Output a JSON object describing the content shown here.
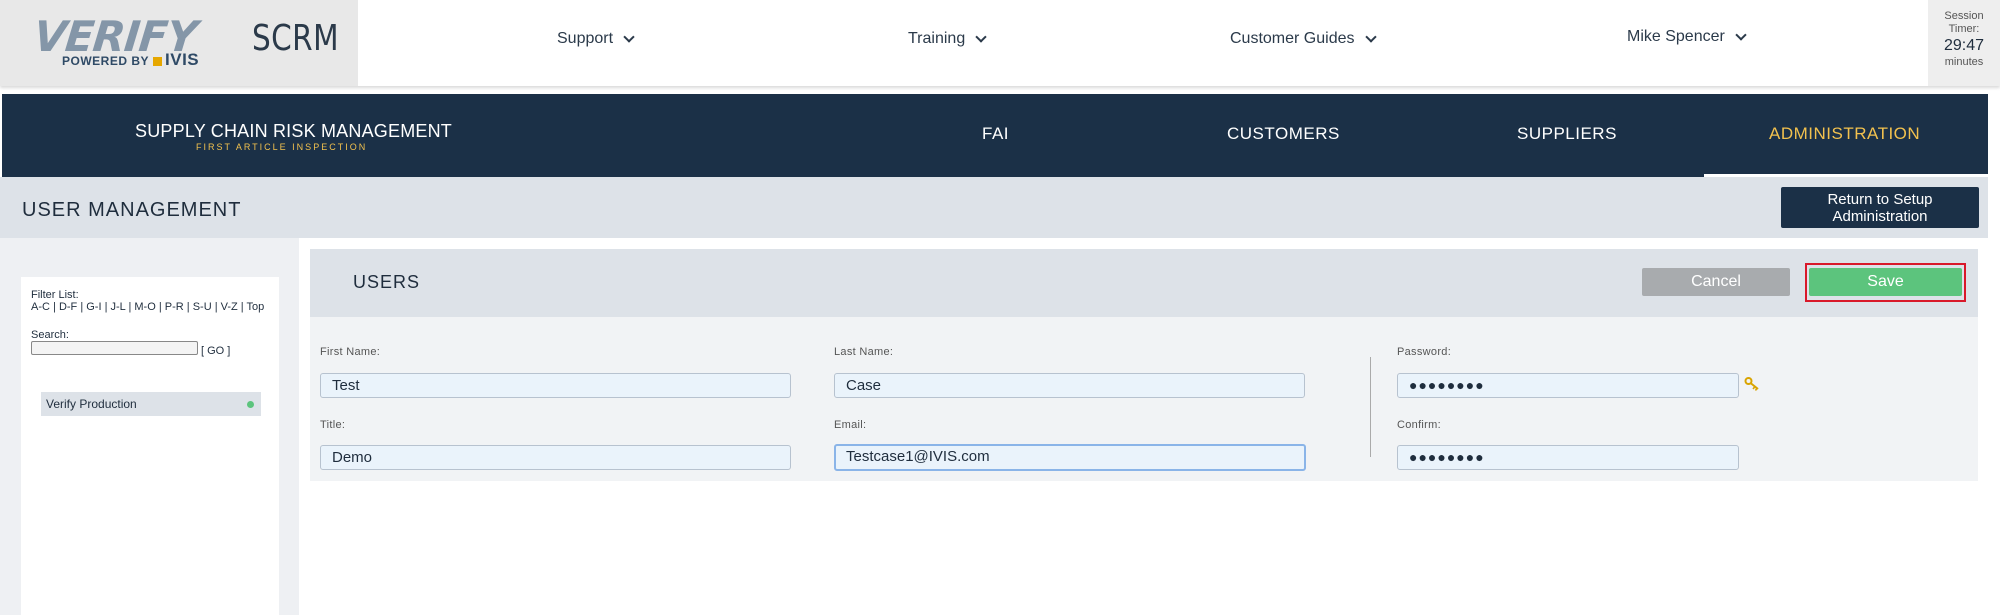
{
  "header": {
    "logo_text": "VERIFY",
    "logo_powered": "POWERED BY",
    "logo_ivis": "IVIS",
    "app_name": "SCRM",
    "nav": [
      "Support",
      "Training",
      "Customer Guides"
    ],
    "user": "Mike Spencer",
    "session": {
      "label1": "Session",
      "label2": "Timer:",
      "time": "29:47",
      "unit": "minutes"
    }
  },
  "mainnav": {
    "brand_title": "SUPPLY CHAIN RISK MANAGEMENT",
    "brand_sub": "FIRST ARTICLE INSPECTION",
    "items": [
      "FAI",
      "CUSTOMERS",
      "SUPPLIERS",
      "ADMINISTRATION"
    ],
    "active": "ADMINISTRATION"
  },
  "page": {
    "title": "USER MANAGEMENT",
    "return_button": "Return to Setup Administration"
  },
  "sidebar": {
    "filter_label": "Filter List:",
    "filter_links": [
      "A-C",
      "D-F",
      "G-I",
      "J-L",
      "M-O",
      "P-R",
      "S-U",
      "V-Z",
      "Top"
    ],
    "search_label": "Search:",
    "go_label": "[ GO ]",
    "tree_item": "Verify Production"
  },
  "users": {
    "title": "USERS",
    "cancel": "Cancel",
    "save": "Save"
  },
  "form": {
    "first_name_label": "First Name:",
    "first_name": "Test",
    "last_name_label": "Last Name:",
    "last_name": "Case",
    "password_label": "Password:",
    "password": "●●●●●●●●",
    "title_label": "Title:",
    "title": "Demo",
    "email_label": "Email:",
    "email": "Testcase1@IVIS.com",
    "confirm_label": "Confirm:",
    "confirm": "●●●●●●●●"
  },
  "colors": {
    "navy": "#1b3047",
    "gold": "#f2c14e",
    "save_green": "#5cc47d",
    "cancel_gray": "#a8abae",
    "highlight_red": "#d9192a"
  }
}
